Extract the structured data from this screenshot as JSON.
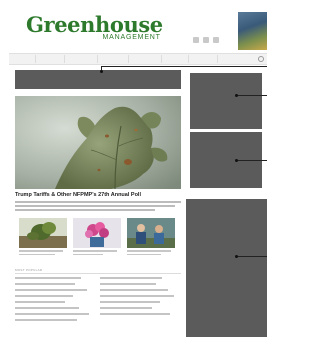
{
  "header": {
    "logo_main": "Greenhouse",
    "logo_sub": "MANAGEMENT"
  },
  "nav": {
    "items": [
      "",
      "",
      "",
      "",
      "",
      "",
      "",
      ""
    ]
  },
  "hero": {
    "title": "Trump Tariffs & Other NFPMP's 27th Annual Poll"
  },
  "list": {
    "heading": "MOST POPULAR"
  },
  "colors": {
    "brand_green": "#2e7a2d",
    "placeholder_gray": "#5b5b5b"
  }
}
